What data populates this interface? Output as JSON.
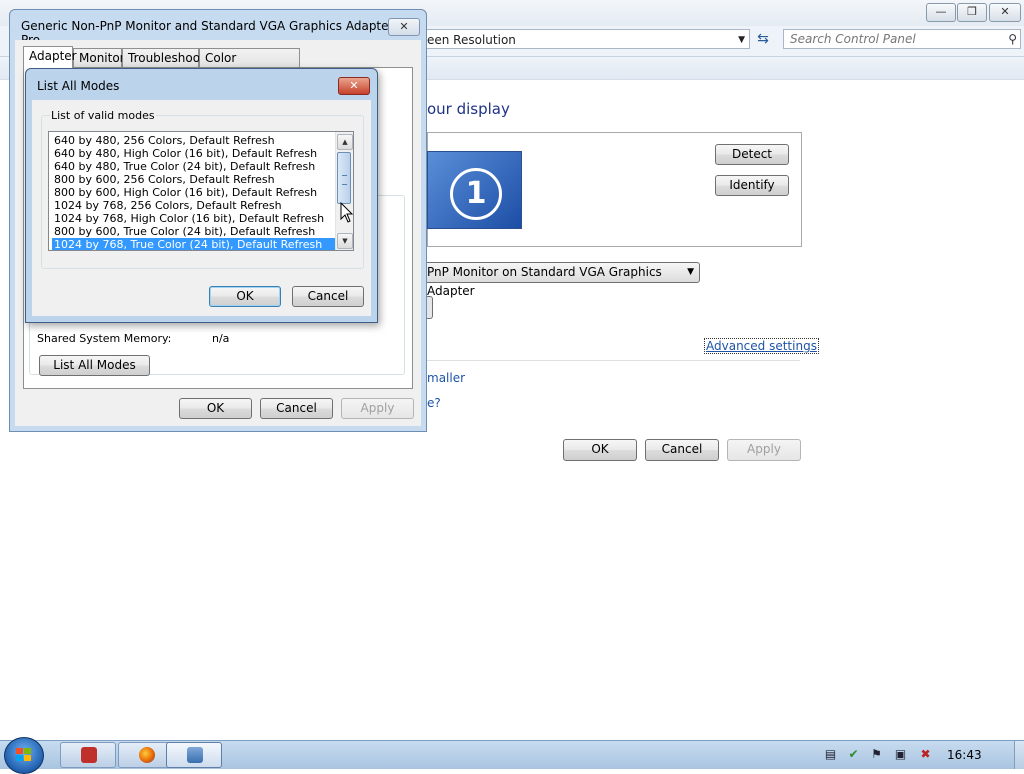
{
  "control_panel": {
    "address_text": "een Resolution",
    "search_placeholder": "Search Control Panel",
    "heading": "our display",
    "detect_label": "Detect",
    "identify_label": "Identify",
    "monitor_number": "1",
    "display_select_value": "PnP Monitor on Standard VGA Graphics Adapter",
    "advanced_settings_label": "Advanced settings",
    "link_smaller": "maller",
    "link_question": "e?",
    "ok_label": "OK",
    "cancel_label": "Cancel",
    "apply_label": "Apply"
  },
  "properties_window": {
    "title": "Generic Non-PnP Monitor and Standard VGA Graphics Adapter Pro...",
    "tabs": [
      {
        "label": "Adapter"
      },
      {
        "label": "Monitor"
      },
      {
        "label": "Troubleshoot"
      },
      {
        "label": "Color Management"
      }
    ],
    "shared_memory_label": "Shared System Memory:",
    "shared_memory_value": "n/a",
    "list_all_modes_label": "List All Modes",
    "ok_label": "OK",
    "cancel_label": "Cancel",
    "apply_label": "Apply"
  },
  "modes_dialog": {
    "title": "List All Modes",
    "group_label": "List of valid modes",
    "modes": [
      "640 by 480, 256 Colors, Default Refresh",
      "640 by 480, High Color (16 bit), Default Refresh",
      "640 by 480, True Color (24 bit), Default Refresh",
      "800 by 600, 256 Colors, Default Refresh",
      "800 by 600, High Color (16 bit), Default Refresh",
      "1024 by 768, 256 Colors, Default Refresh",
      "1024 by 768, High Color (16 bit), Default Refresh",
      "800 by 600, True Color (24 bit), Default Refresh",
      "1024 by 768, True Color (24 bit), Default Refresh"
    ],
    "selected_index": 8,
    "ok_label": "OK",
    "cancel_label": "Cancel"
  },
  "taskbar": {
    "clock": "16:43"
  },
  "colors": {
    "accent": "#3399ff",
    "link": "#1e54a8",
    "heading": "#1e3287"
  }
}
